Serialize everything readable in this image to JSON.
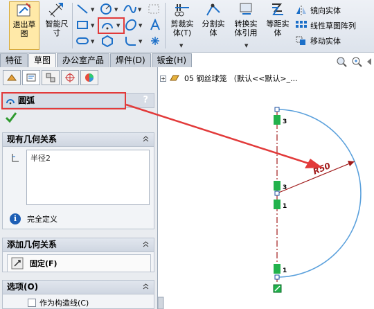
{
  "toolbar": {
    "exit_sketch_label": "退出草图",
    "smart_dim_label": "智能尺寸",
    "trim_label": "剪裁实体(T)",
    "split_label": "分割实体",
    "convert_label": "转换实体引用",
    "offset_label": "等距实体",
    "mirror_label": "镜向实体",
    "linear_pattern_label": "线性草图阵列",
    "move_label": "移动实体"
  },
  "tabs": [
    {
      "label": "特征"
    },
    {
      "label": "草图"
    },
    {
      "label": "办公室产品"
    },
    {
      "label": "焊件(D)"
    },
    {
      "label": "钣金(H)"
    }
  ],
  "panel": {
    "title": "圆弧",
    "help": "?",
    "existing_relations": {
      "title": "现有几何关系",
      "items": [
        "半径2"
      ],
      "status": "完全定义",
      "info_glyph": "i"
    },
    "add_relations": {
      "title": "添加几何关系",
      "fix_label": "固定(F)"
    },
    "options": {
      "title": "选项(O)",
      "construction_label": "作为构造线(C)"
    }
  },
  "tree": {
    "expand": "+",
    "item_label": "05 钢丝球笼 （默认<<默认>_..."
  },
  "sketch": {
    "dimension": "R50",
    "arc_color": "#5aa0dc",
    "relation_labels": [
      "3",
      "3",
      "1",
      "1"
    ],
    "annotation_color": "#e23a3a"
  }
}
